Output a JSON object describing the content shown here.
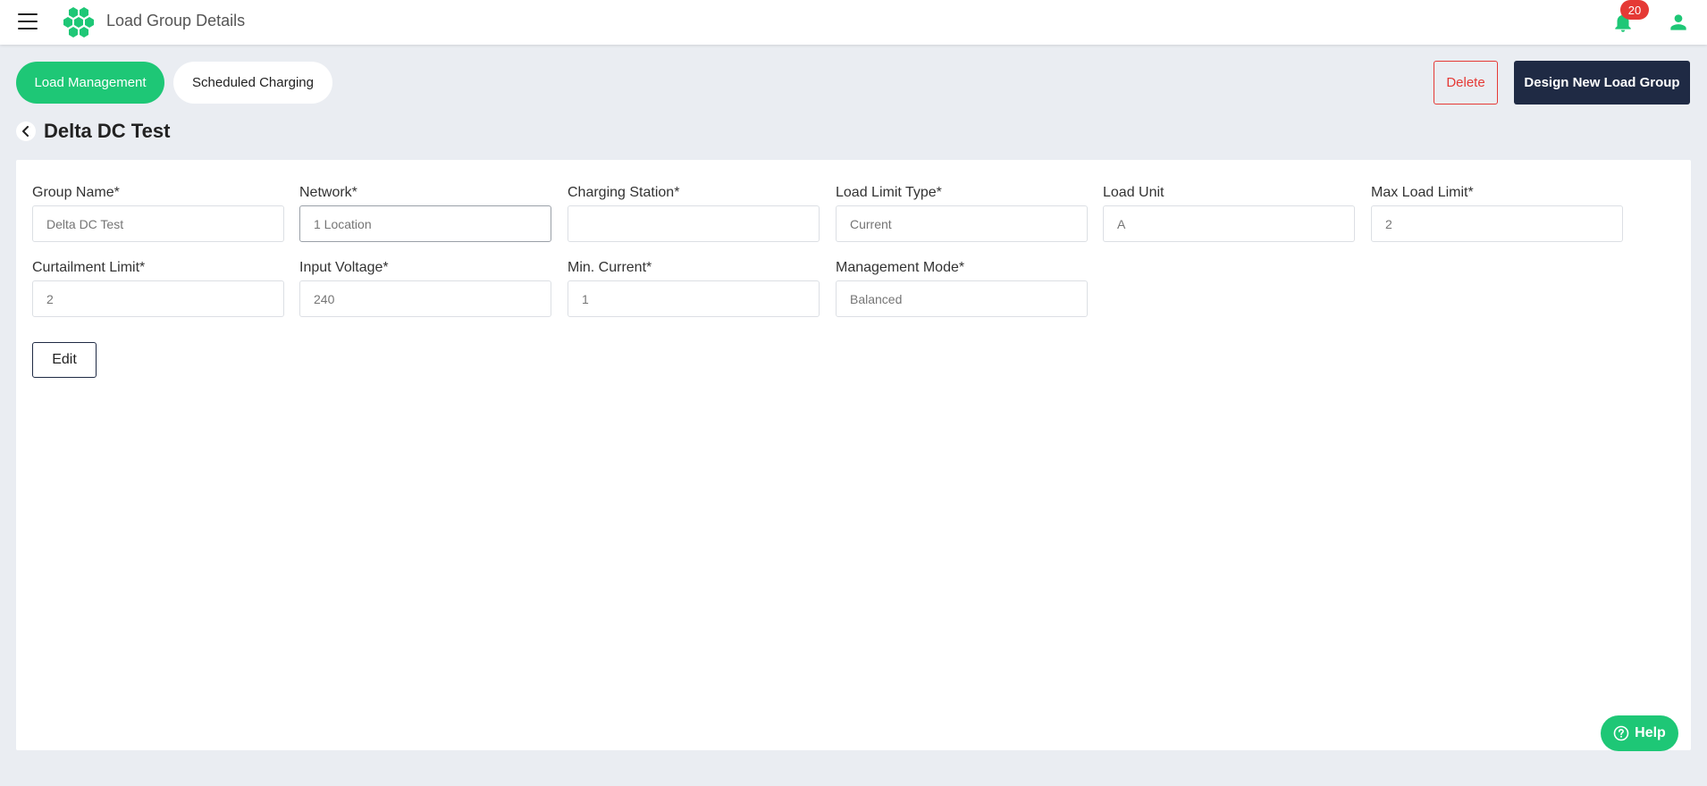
{
  "header": {
    "title": "Load Group Details",
    "notification_count": "20"
  },
  "tabs": [
    {
      "label": "Load Management",
      "active": true
    },
    {
      "label": "Scheduled Charging",
      "active": false
    }
  ],
  "actions": {
    "delete_label": "Delete",
    "design_label": "Design New Load Group"
  },
  "page": {
    "title": "Delta DC Test"
  },
  "form": {
    "fields": [
      {
        "label": "Group Name*",
        "value": "Delta DC Test"
      },
      {
        "label": "Network*",
        "value": "1 Location"
      },
      {
        "label": "Charging Station*",
        "value": ""
      },
      {
        "label": "Load Limit Type*",
        "value": "Current"
      },
      {
        "label": "Load Unit",
        "value": "A"
      },
      {
        "label": "Max Load Limit*",
        "value": "2"
      },
      {
        "label": "Curtailment Limit*",
        "value": "2"
      },
      {
        "label": "Input Voltage*",
        "value": "240"
      },
      {
        "label": "Min. Current*",
        "value": "1"
      },
      {
        "label": "Management Mode*",
        "value": "Balanced"
      }
    ],
    "edit_label": "Edit"
  },
  "help": {
    "label": "Help"
  },
  "colors": {
    "accent": "#1ec776",
    "navy": "#1f2a44",
    "danger": "#e53935",
    "background": "#eaedf2"
  }
}
